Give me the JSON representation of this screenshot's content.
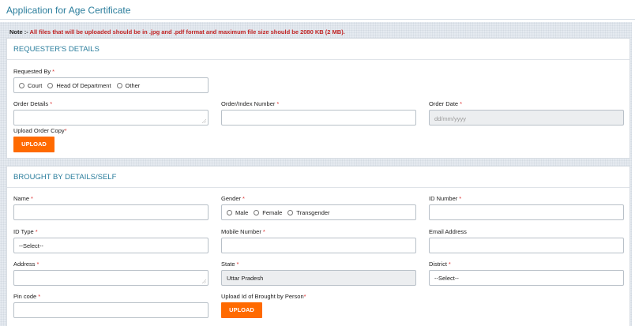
{
  "page": {
    "title": "Application for Age Certificate"
  },
  "note": {
    "prefix": "Note :-",
    "text": " All files that will be uploaded should be in .jpg and .pdf format and maximum file size should be 2080 KB (2 MB)."
  },
  "colors": {
    "accent": "#2a7d9c",
    "button": "#ff6a00",
    "required": "#dd3333",
    "note": "#c02424"
  },
  "requester": {
    "title": "REQUESTER'S DETAILS",
    "requested_by_label": "Requested By",
    "requested_by_options": [
      "Court",
      "Head Of Department",
      "Other"
    ],
    "order_details_label": "Order Details",
    "order_index_label": "Order/Index Number",
    "order_date_label": "Order Date",
    "order_date_placeholder": "dd/mm/yyyy",
    "upload_order_copy_label": "Upload Order Copy",
    "upload_button": "UPLOAD",
    "required_mark": "*"
  },
  "brought_by": {
    "title": "BROUGHT BY DETAILS/SELF",
    "name_label": "Name",
    "gender_label": "Gender",
    "gender_options": [
      "Male",
      "Female",
      "Transgender"
    ],
    "id_number_label": "ID Number",
    "id_type_label": "ID Type",
    "id_type_value": "--Select--",
    "mobile_label": "Mobile Number",
    "email_label": "Email Address",
    "address_label": "Address",
    "state_label": "State",
    "state_value": "Uttar Pradesh",
    "district_label": "District",
    "district_value": "--Select--",
    "pincode_label": "Pin code",
    "upload_id_label": "Upload Id of Brought by Person",
    "upload_button": "UPLOAD",
    "required_mark": "*"
  }
}
